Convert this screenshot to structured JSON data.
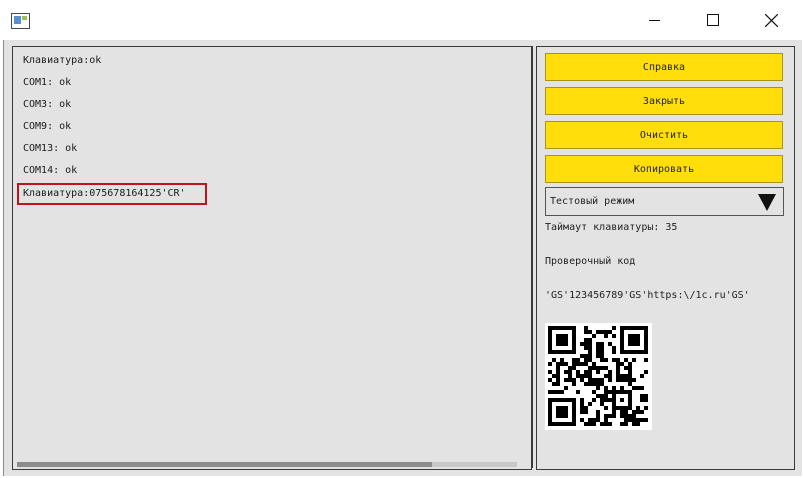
{
  "window": {
    "icon": "app-window-icon",
    "controls": [
      "minimize-icon",
      "maximize-icon",
      "close-icon"
    ]
  },
  "log": {
    "lines": [
      "Клавиатура:ok",
      "COM1: ok",
      "COM3: ok",
      "COM9: ok",
      "COM13: ok",
      "COM14: ok",
      "Клавиатура:075678164125'CR'"
    ],
    "highlight_color": "#c1121f",
    "scroll_position": 0.83
  },
  "buttons": {
    "help": "Справка",
    "close": "Закрыть",
    "clear": "Очистить",
    "copy": "Копировать",
    "color": "#ffde0b"
  },
  "mode_select": {
    "value": "Тестовый режим",
    "icon": "dropdown-arrow-icon"
  },
  "info": {
    "keyboard_timeout": "Таймаут клавиатуры: 35",
    "verification_label": "Проверочный код",
    "verification_value": "'GS'123456789'GS'https:\\/1c.ru'GS'"
  },
  "qr_code": {
    "icon": "qr-code-image"
  }
}
